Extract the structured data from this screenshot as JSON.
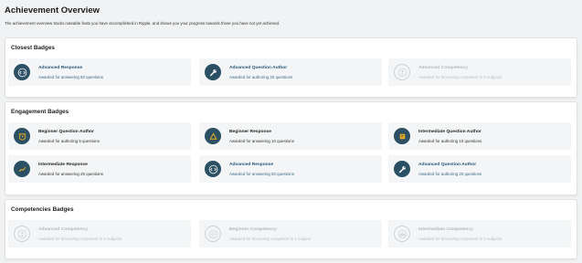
{
  "page": {
    "title": "Achievement Overview",
    "subtitle": "The achievement overview tracks noteable feats you have accomplished in Ripple, and shows you your progress towards those you have not yet achieved."
  },
  "sections": [
    {
      "title": "Closest Badges",
      "badges": [
        {
          "name": "Advanced Response",
          "desc": "Awarded for answering 50 questions",
          "icon": "code-icon",
          "state": "progress"
        },
        {
          "name": "Advanced Question Author",
          "desc": "Awarded for authoring 20 questions",
          "icon": "wrench-icon",
          "state": "progress"
        },
        {
          "name": "Advanced Competency",
          "desc": "Awarded for becoming competent in 5 subjects",
          "icon": "person-icon",
          "state": "locked"
        }
      ]
    },
    {
      "title": "Engagement Badges",
      "badges": [
        {
          "name": "Beginner Question Author",
          "desc": "Awarded for authoring 5 questions",
          "icon": "alarm-clock-icon",
          "state": "earned"
        },
        {
          "name": "Beginner Response",
          "desc": "Awarded for answering 10 questions",
          "icon": "triangle-warning-icon",
          "state": "earned"
        },
        {
          "name": "Intermediate Question Author",
          "desc": "Awarded for authoring 10 questions",
          "icon": "note-icon",
          "state": "earned"
        },
        {
          "name": "Intermediate Response",
          "desc": "Awarded for answering 25 questions",
          "icon": "trend-line-icon",
          "state": "earned"
        },
        {
          "name": "Advanced Response",
          "desc": "Awarded for answering 50 questions",
          "icon": "code-icon",
          "state": "progress"
        },
        {
          "name": "Advanced Question Author",
          "desc": "Awarded for authoring 20 questions",
          "icon": "wrench-icon",
          "state": "progress"
        }
      ]
    },
    {
      "title": "Competencies Badges",
      "badges": [
        {
          "name": "Advanced Competency",
          "desc": "Awarded for becoming competent in 5 subjects",
          "icon": "person-icon",
          "state": "locked"
        },
        {
          "name": "Beginner Competency",
          "desc": "Awarded for becoming competent in 1 subject",
          "icon": "gear-badge-icon",
          "state": "locked"
        },
        {
          "name": "Intermediate Competency",
          "desc": "Awarded for becoming competent in 3 subjects",
          "icon": "bicycle-icon",
          "state": "locked"
        }
      ]
    }
  ],
  "colors": {
    "earned_icon_bg": "#2b4f63",
    "gold": "#f2b01e",
    "progress_text": "#23577a",
    "locked_text": "#b5b7b9"
  }
}
